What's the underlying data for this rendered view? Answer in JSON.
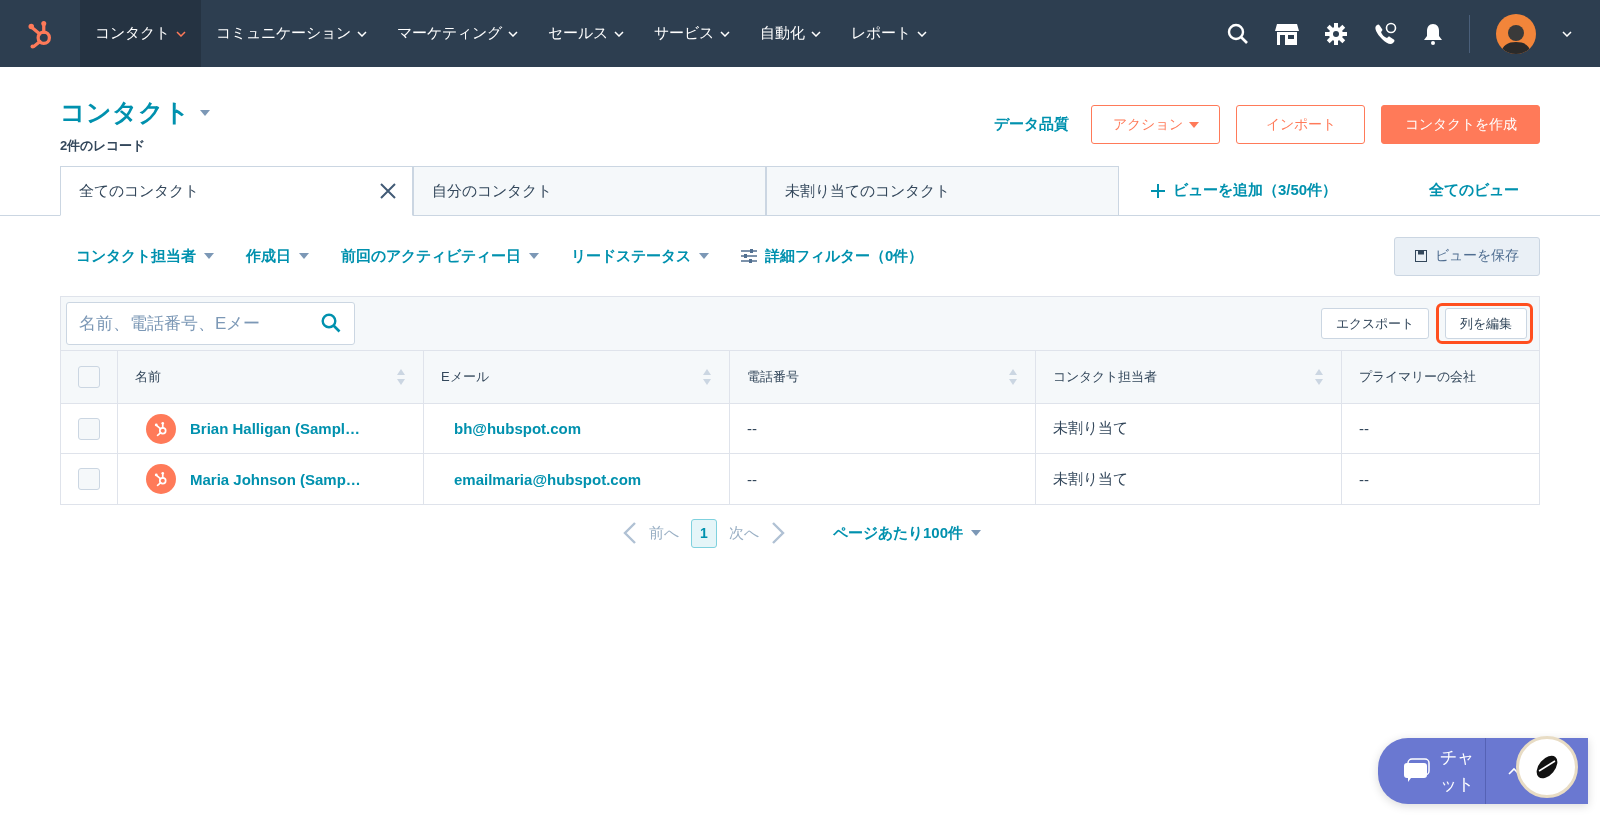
{
  "nav": {
    "items": [
      {
        "label": "コンタクト",
        "selected": true
      },
      {
        "label": "コミュニケーション",
        "selected": false
      },
      {
        "label": "マーケティング",
        "selected": false
      },
      {
        "label": "セールス",
        "selected": false
      },
      {
        "label": "サービス",
        "selected": false
      },
      {
        "label": "自動化",
        "selected": false
      },
      {
        "label": "レポート",
        "selected": false
      }
    ]
  },
  "header": {
    "title": "コンタクト",
    "record_count": "2件のレコード",
    "data_quality": "データ品質",
    "buttons": [
      {
        "label": "アクション",
        "kind": "dropdown"
      },
      {
        "label": "インポート",
        "kind": "outline"
      },
      {
        "label": "コンタクトを作成",
        "kind": "primary"
      }
    ]
  },
  "view_tabs": [
    {
      "label": "全てのコンタクト",
      "selected": true
    },
    {
      "label": "自分のコンタクト",
      "selected": false
    },
    {
      "label": "未割り当てのコンタクト",
      "selected": false
    }
  ],
  "add_view": "ビューを追加（3/50件）",
  "all_views": "全てのビュー",
  "filters": [
    "コンタクト担当者",
    "作成日",
    "前回のアクティビティー日",
    "リードステータス"
  ],
  "advanced_filter": "詳細フィルター（0件）",
  "save_view": "ビューを保存",
  "table": {
    "search": {
      "placeholder": "名前、電話番号、Eメー"
    },
    "export": "エクスポート",
    "edit_columns": {
      "label": "列を編集",
      "highlighted": true
    },
    "select_all": {
      "checked": false
    },
    "columns": [
      {
        "label": "名前",
        "sortable": true
      },
      {
        "label": "Eメール",
        "sortable": true
      },
      {
        "label": "電話番号",
        "sortable": true
      },
      {
        "label": "コンタクト担当者",
        "sortable": true
      },
      {
        "label": "プライマリーの会社",
        "sortable": false
      }
    ],
    "rows": [
      {
        "checked": false,
        "name": "Brian Halligan (Sampl…",
        "email": "bh@hubspot.com",
        "phone": "--",
        "owner": "未割り当て",
        "company": "--"
      },
      {
        "checked": false,
        "name": "Maria Johnson (Samp…",
        "email": "emailmaria@hubspot.com",
        "phone": "--",
        "owner": "未割り当て",
        "company": "--"
      }
    ]
  },
  "pagination": {
    "prev": "前へ",
    "page": "1",
    "next": "次へ",
    "per_page": "ページあたり100件"
  },
  "chat": {
    "label": "チャット"
  }
}
